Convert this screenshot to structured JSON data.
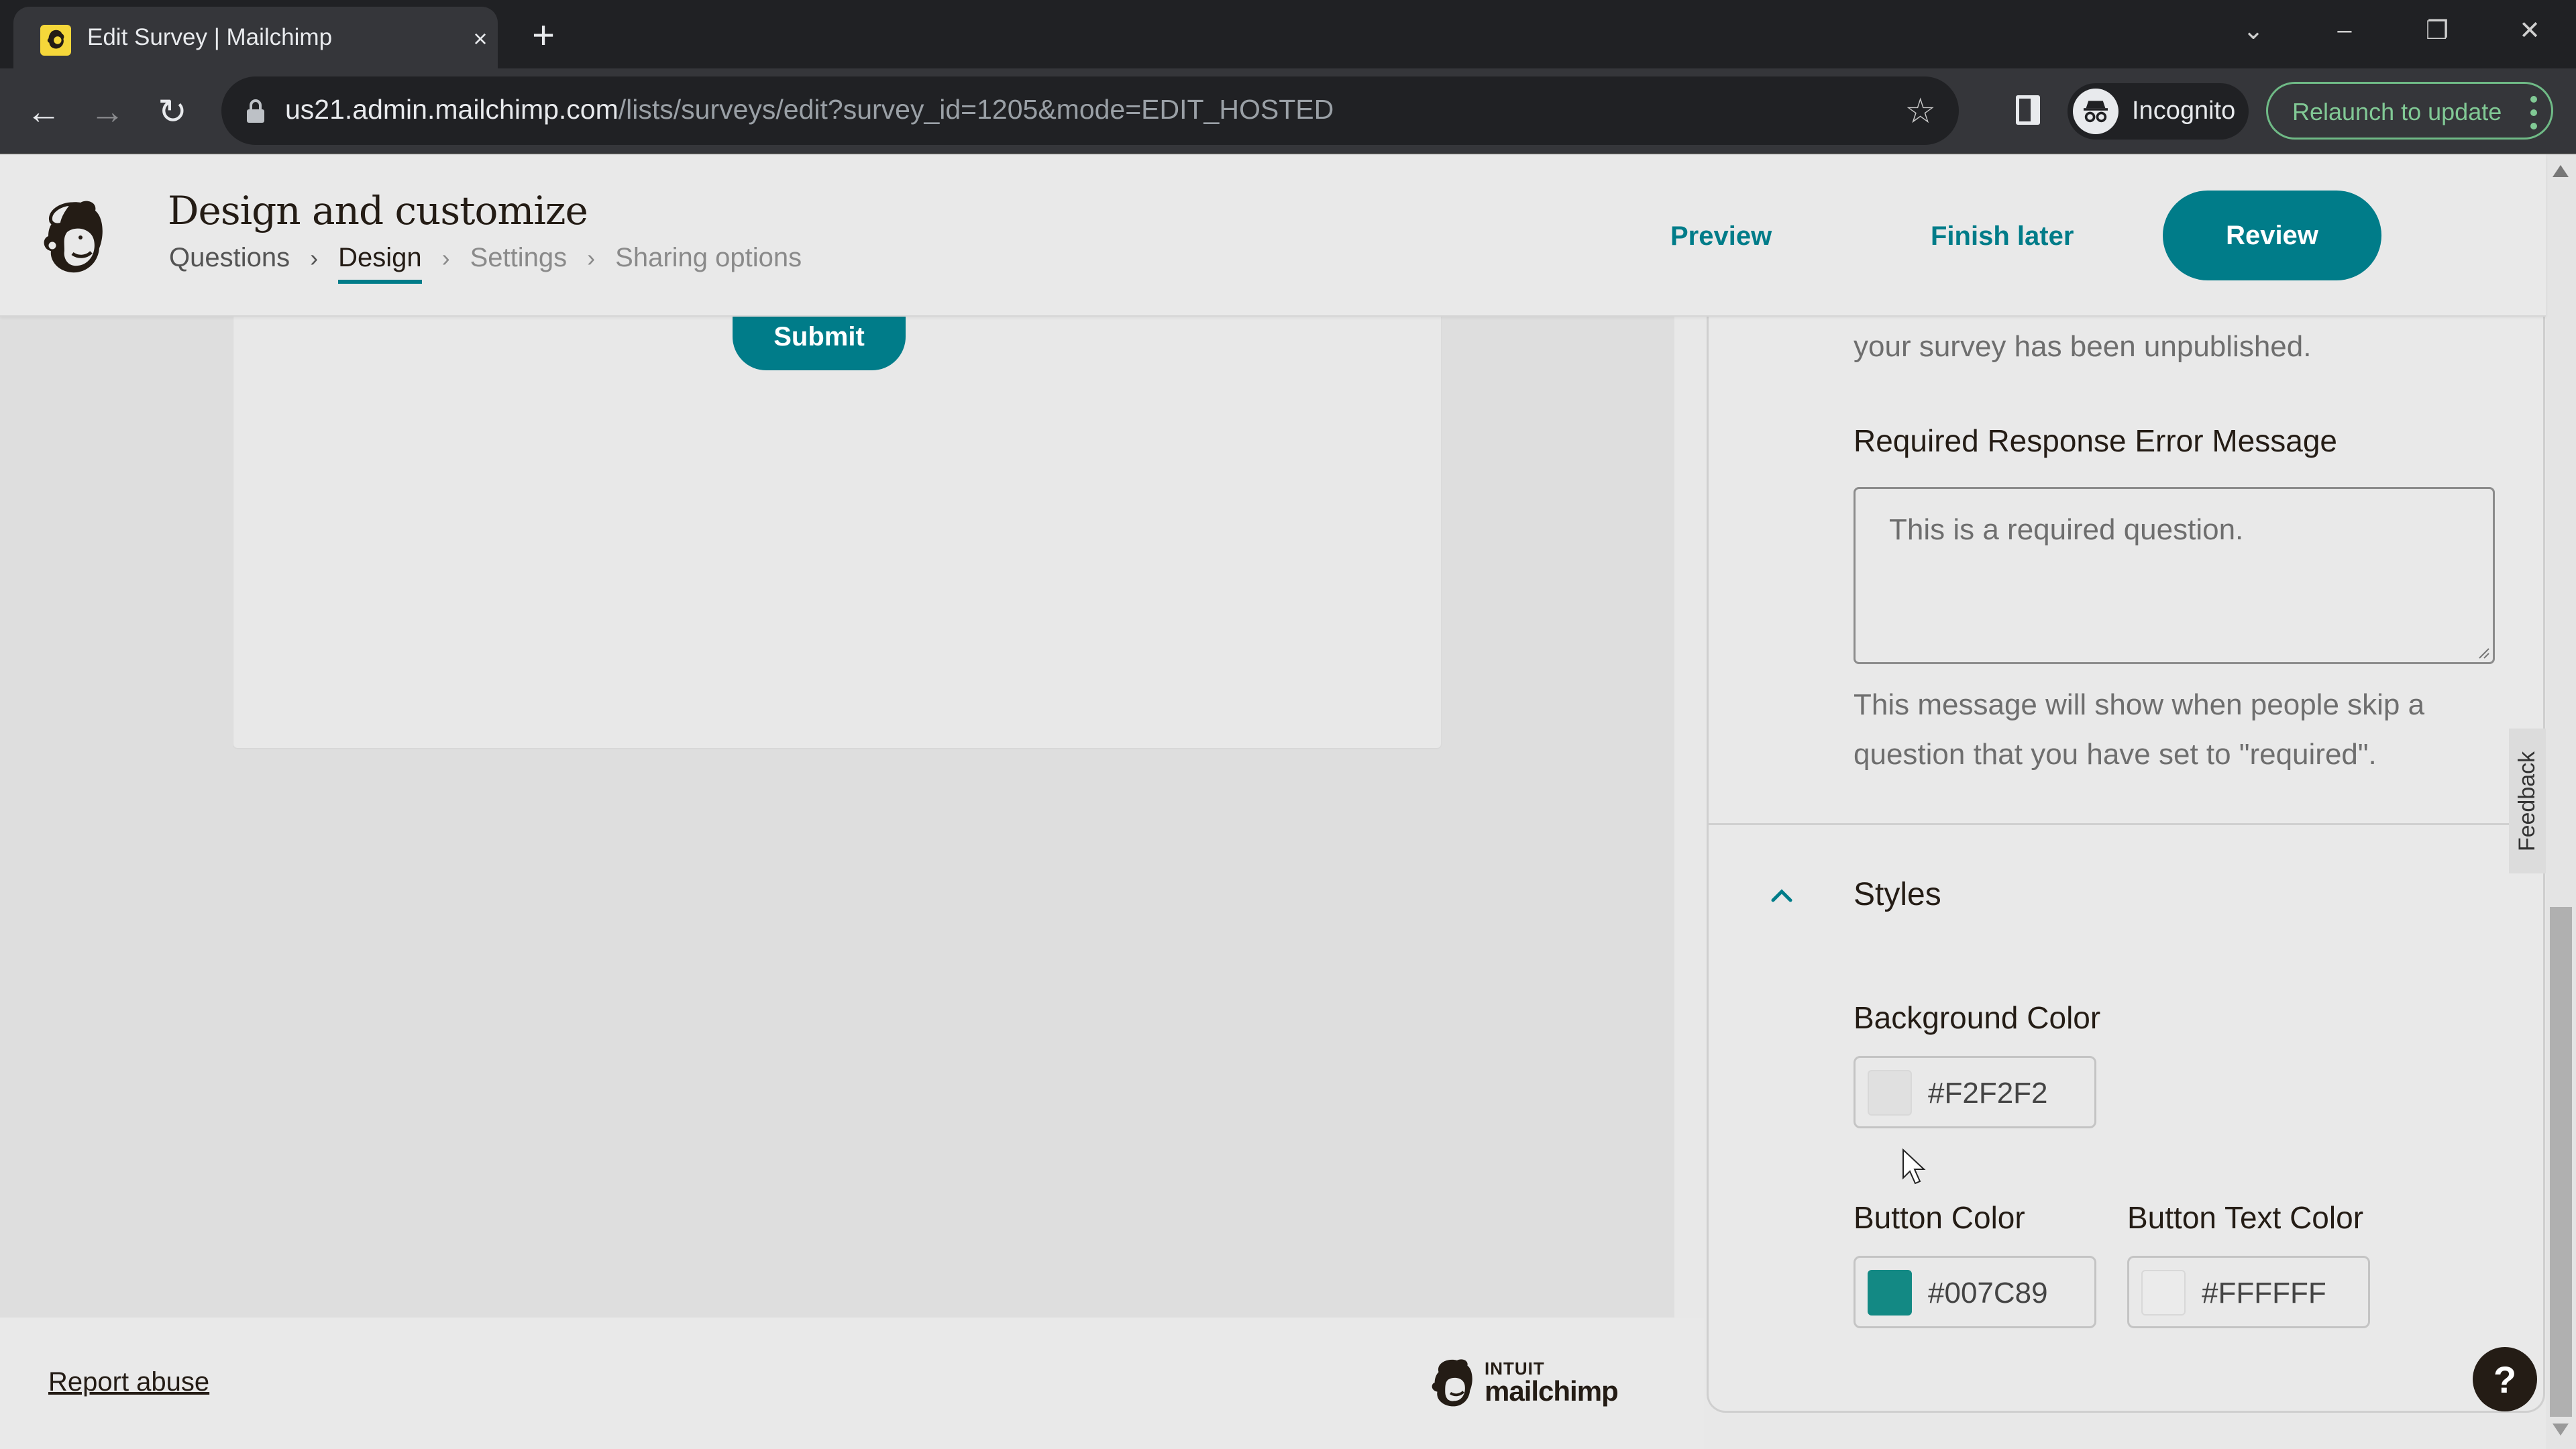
{
  "browser": {
    "tab_title": "Edit Survey | Mailchimp",
    "url_host": "us21.admin.mailchimp.com",
    "url_path": "/lists/surveys/edit?survey_id=1205&mode=EDIT_HOSTED",
    "profile_label": "Incognito",
    "relaunch_label": "Relaunch to update",
    "icons": {
      "close_tab": "×",
      "new_tab": "+",
      "back": "←",
      "forward": "→",
      "reload": "↻",
      "star": "☆",
      "tab_search": "⌄",
      "minimize": "–",
      "restore": "❐",
      "close_window": "✕"
    }
  },
  "header": {
    "title": "Design and customize",
    "breadcrumbs": [
      {
        "label": "Questions",
        "state": "done"
      },
      {
        "label": "Design",
        "state": "active"
      },
      {
        "label": "Settings",
        "state": "future"
      },
      {
        "label": "Sharing options",
        "state": "future"
      }
    ],
    "separator": "›",
    "preview_label": "Preview",
    "finish_later_label": "Finish later",
    "review_label": "Review"
  },
  "preview": {
    "submit_label": "Submit"
  },
  "footer": {
    "report_abuse": "Report abuse",
    "brand_line1": "INTUIT",
    "brand_line2": "mailchimp"
  },
  "panel": {
    "unpublished_tail": "your survey has been unpublished.",
    "required_label": "Required Response Error Message",
    "required_placeholder": "This is a required question.",
    "required_help": "This message will show when people skip a question that you have set to \"required\".",
    "styles_title": "Styles",
    "background_color_label": "Background Color",
    "background_color": "#F2F2F2",
    "button_color_label": "Button Color",
    "button_color": "#007C89",
    "button_text_color_label": "Button Text Color",
    "button_text_color": "#FFFFFF",
    "feedback_label": "Feedback",
    "help_label": "?"
  },
  "colors": {
    "accent": "#007c89",
    "text_dark": "#241c15",
    "relaunch_green": "#81c995"
  }
}
